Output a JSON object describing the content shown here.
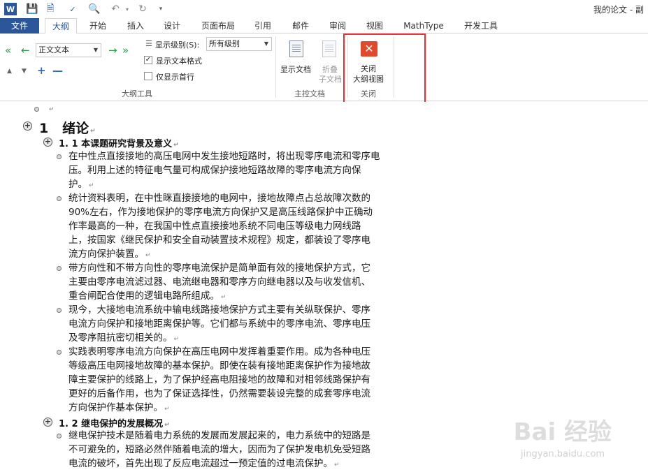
{
  "titlebar": {
    "doc_title": "我的论文 - 副",
    "word_icon": "W"
  },
  "tabs": [
    "文件",
    "大纲",
    "开始",
    "插入",
    "设计",
    "页面布局",
    "引用",
    "邮件",
    "审阅",
    "视图",
    "MathType",
    "开发工具"
  ],
  "ribbon": {
    "style_select": "正文文本",
    "show_level_label": "显示级别(S):",
    "show_level_value": "所有级别",
    "show_text_format": "显示文本格式",
    "show_first_line": "仅显示首行",
    "group_outline_tools": "大纲工具",
    "show_document": "显示文档",
    "collapse_subdoc_1": "折叠",
    "collapse_subdoc_2": "子文档",
    "group_master_doc": "主控文档",
    "close_outline_1": "关闭",
    "close_outline_2": "大纲视图",
    "group_close": "关闭"
  },
  "document": {
    "h1": {
      "num": "1",
      "text": "绪论"
    },
    "h2a": "1. 1 本课题研究背景及意义",
    "h2b": "1. 2 继电保护的发展概况",
    "p1": [
      "在中性点直接接地的高压电网中发生接地短路时，将出现零序电流和零序电",
      "压。利用上述的特征电气量可构成保护接地短路故障的零序电流方向保",
      "护。"
    ],
    "p2": [
      "统计资料表明，在中性眯直接接地的电网中，接地故障点占总故障次数的",
      "90%左右，作为接地保护的零序电流方向保护又是高压线路保护中正确动",
      "作率最高的一种，在我国中性点直接接地系统不同电压等级电力网线路",
      "上，按国家《继民保护和安全自动装置技术规程》规定，都装设了零序电",
      "流方向保护装置。"
    ],
    "p3": [
      "带方向性和不带方向性的零序电流保护是简单面有效的接地保护方式，它",
      "主要由零序电流滤过器、电流继电器和零序方向继电器以及与收发信机、",
      "重合闸配合使用的逻辑电路所组成。"
    ],
    "p4": [
      "现今，大接地电流系统中输电线路接地保护方式主要有关纵联保护、零序",
      "电流方向保护和接地距离保护等。它们都与系统中的零序电流、零序电压",
      "及零序阻抗密切相关的。"
    ],
    "p5": [
      "实践表明零序电流方向保护在高压电网中发挥着重要作用。成为各种电压",
      "等级高压电网接地故障的基本保护。即使在装有接地距离保护作为接地故",
      "障主要保护的线路上，为了保护经高电阻接地的故障和对相邻线路保护有",
      "更好的后备作用，也为了保证选择性，仍然需要装设完整的成套零序电流",
      "方向保护作基本保护。"
    ],
    "p6": [
      "继电保护技术是随着电力系统的发展而发展起来的，电力系统中的短路是",
      "不可避免的，短路必然伴随着电流的增大，因而为了保护发电机免受短路",
      "电流的破坏，首先出现了反应电流超过一预定值的过电流保护。"
    ]
  },
  "watermark": {
    "main": "Bai 经验",
    "sub": "jingyan.baidu.com"
  }
}
